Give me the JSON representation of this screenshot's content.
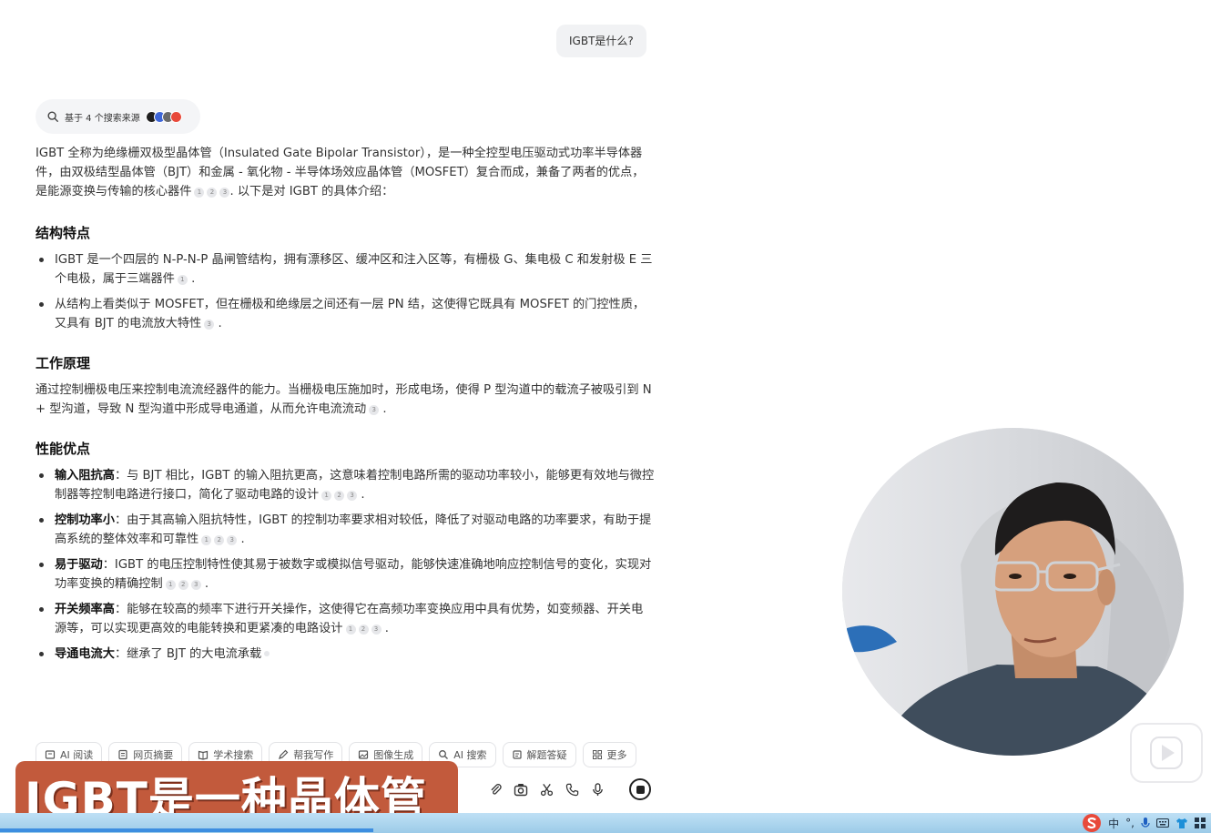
{
  "user_question": "IGBT是什么?",
  "sources": {
    "label": "基于 4 个搜索来源",
    "avatar_colors": [
      "#1f1f1f",
      "#3e66d8",
      "#6a6a6a",
      "#e8493a"
    ]
  },
  "answer": {
    "intro": "IGBT 全称为绝缘栅双极型晶体管（Insulated Gate Bipolar Transistor），是一种全控型电压驱动式功率半导体器件，由双极结型晶体管（BJT）和金属 - 氧化物 - 半导体场效应晶体管（MOSFET）复合而成，兼备了两者的优点，是能源变换与传输的核心器件",
    "intro_tail": ". 以下是对 IGBT 的具体介绍：",
    "sections": [
      {
        "heading": "结构特点",
        "items": [
          {
            "text": "IGBT 是一个四层的 N-P-N-P 晶闸管结构，拥有漂移区、缓冲区和注入区等，有栅极 G、集电极 C 和发射极 E 三个电极，属于三端器件",
            "cites": [
              "1"
            ]
          },
          {
            "text": "从结构上看类似于 MOSFET，但在栅极和绝缘层之间还有一层 PN 结，这使得它既具有 MOSFET 的门控性质，又具有 BJT 的电流放大特性",
            "cites": [
              "3"
            ]
          }
        ]
      },
      {
        "heading": "工作原理",
        "paragraph": "通过控制栅极电压来控制电流流经器件的能力。当栅极电压施加时，形成电场，使得 P 型沟道中的载流子被吸引到 N + 型沟道，导致 N 型沟道中形成导电通道，从而允许电流流动",
        "cites": [
          "3"
        ]
      },
      {
        "heading": "性能优点",
        "items": [
          {
            "bold": "输入阻抗高",
            "text": "：与 BJT 相比，IGBT 的输入阻抗更高，这意味着控制电路所需的驱动功率较小，能够更有效地与微控制器等控制电路进行接口，简化了驱动电路的设计",
            "cites": [
              "1",
              "2",
              "3"
            ]
          },
          {
            "bold": "控制功率小",
            "text": "：由于其高输入阻抗特性，IGBT 的控制功率要求相对较低，降低了对驱动电路的功率要求，有助于提高系统的整体效率和可靠性",
            "cites": [
              "1",
              "2",
              "3"
            ]
          },
          {
            "bold": "易于驱动",
            "text": "：IGBT 的电压控制特性使其易于被数字或模拟信号驱动，能够快速准确地响应控制信号的变化，实现对功率变换的精确控制",
            "cites": [
              "1",
              "2",
              "3"
            ]
          },
          {
            "bold": "开关频率高",
            "text": "：能够在较高的频率下进行开关操作，这使得它在高频功率变换应用中具有优势，如变频器、开关电源等，可以实现更高效的电能转换和更紧凑的电路设计",
            "cites": [
              "1",
              "2",
              "3"
            ]
          },
          {
            "bold": "导通电流大",
            "text": "：继承了 BJT 的大电流承载",
            "cites": []
          }
        ]
      }
    ]
  },
  "toolbar": [
    "AI 阅读",
    "网页摘要",
    "学术搜索",
    "帮我写作",
    "图像生成",
    "AI 搜索",
    "解题答疑",
    "更多"
  ],
  "caption": "IGBT是一种晶体管",
  "tray": {
    "ime": "中"
  },
  "colors": {
    "caption_bg": "#c25a3c",
    "accent": "#3d8ee0"
  }
}
